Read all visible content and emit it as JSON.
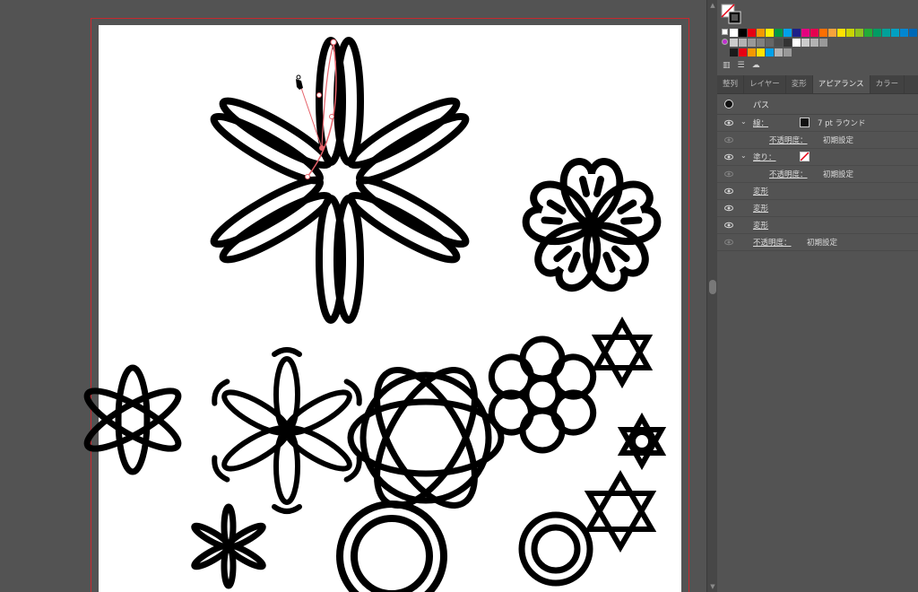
{
  "swatches": {
    "row1": [
      "#ffffff",
      "#000000",
      "#e60012",
      "#f39800",
      "#fff100",
      "#009944",
      "#00a0e9",
      "#1d2088",
      "#e4007f",
      "#e5004f",
      "#ff6f00",
      "#f7a23b",
      "#ffe100",
      "#c9d500",
      "#8fc31f",
      "#22ac38",
      "#009b63",
      "#00a199",
      "#00a0c1",
      "#0086d1",
      "#0068b7"
    ],
    "row2": [
      "#cccccc",
      "#b3b3b3",
      "#999999",
      "#808080",
      "#666666",
      "#4d4d4d",
      "#333333",
      "#ffffff",
      "#cccccc",
      "#b3b3b3",
      "#999999"
    ],
    "row3": [
      "#1a1a1a",
      "#e60012",
      "#f39800",
      "#ffe100",
      "#00a0e9",
      "#b3b3b3",
      "#999999"
    ]
  },
  "tabs": [
    {
      "label": "整列",
      "active": false
    },
    {
      "label": "レイヤー",
      "active": false
    },
    {
      "label": "変形",
      "active": false
    },
    {
      "label": "アピアランス",
      "active": true
    },
    {
      "label": "カラー",
      "active": false
    }
  ],
  "appearance": {
    "target": "パス",
    "stroke_label": "線：",
    "stroke_value": "7 pt ラウンド",
    "stroke_opacity_label": "不透明度：",
    "stroke_opacity_value": "初期設定",
    "fill_label": "塗り：",
    "fill_opacity_label": "不透明度：",
    "fill_opacity_value": "初期設定",
    "effects": [
      "変形",
      "変形",
      "変形"
    ],
    "opacity_label": "不透明度：",
    "opacity_value": "初期設定"
  },
  "colors": {
    "panel_bg": "#535353",
    "tab_bg": "#424242",
    "artboard_bleed": "#c8282d",
    "selection": "#e6636b",
    "artwork_stroke": "#000000"
  },
  "icons": [
    "fill-stroke-icon",
    "eye-icon",
    "chevron-down-icon",
    "pen-tool-icon",
    "scroll-up-icon",
    "scroll-down-icon"
  ]
}
